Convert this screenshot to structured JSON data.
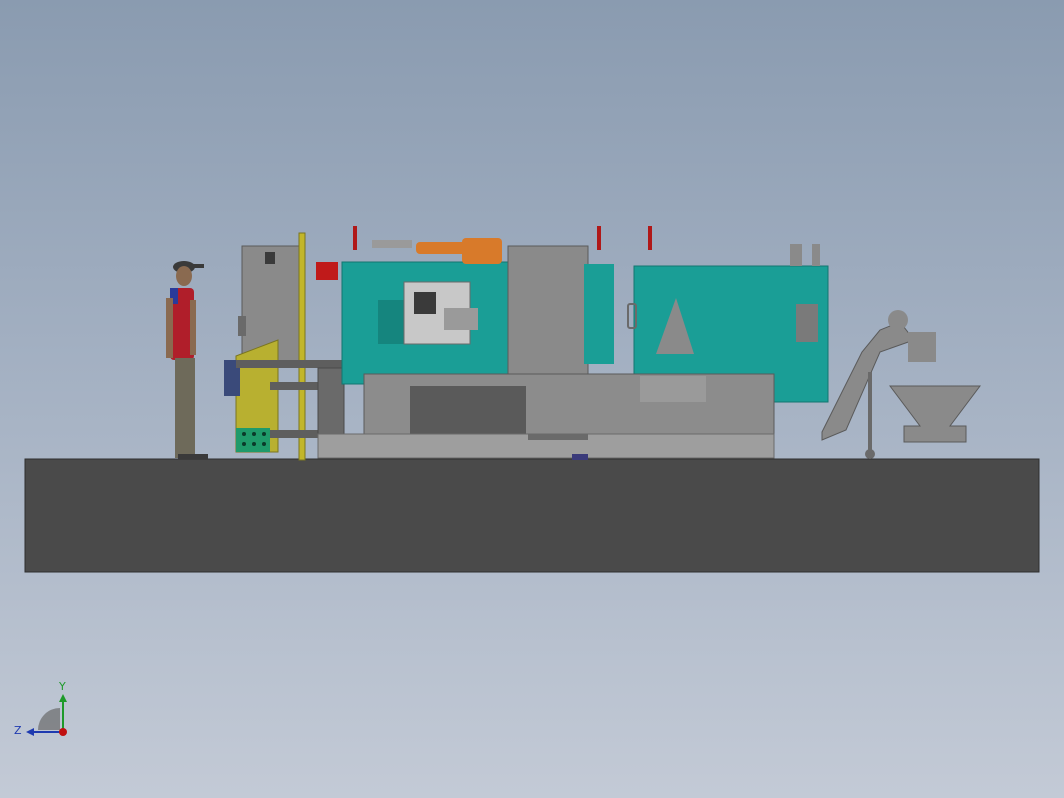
{
  "viewport": {
    "background_top": "#8a9bb0",
    "background_bottom": "#c3cad6"
  },
  "scene": {
    "floor_color": "#4a4a4a",
    "machine_body_color": "#1a9e96",
    "frame_color": "#7a7a7a",
    "robot_color": "#d87a2a",
    "fixture_color": "#b8b030",
    "marker_color": "#b01818"
  },
  "triad": {
    "y_label": "Y",
    "z_label": "Z",
    "y_color": "#1e9a2a",
    "z_color": "#1e3ab0",
    "x_color": "#c01010"
  }
}
